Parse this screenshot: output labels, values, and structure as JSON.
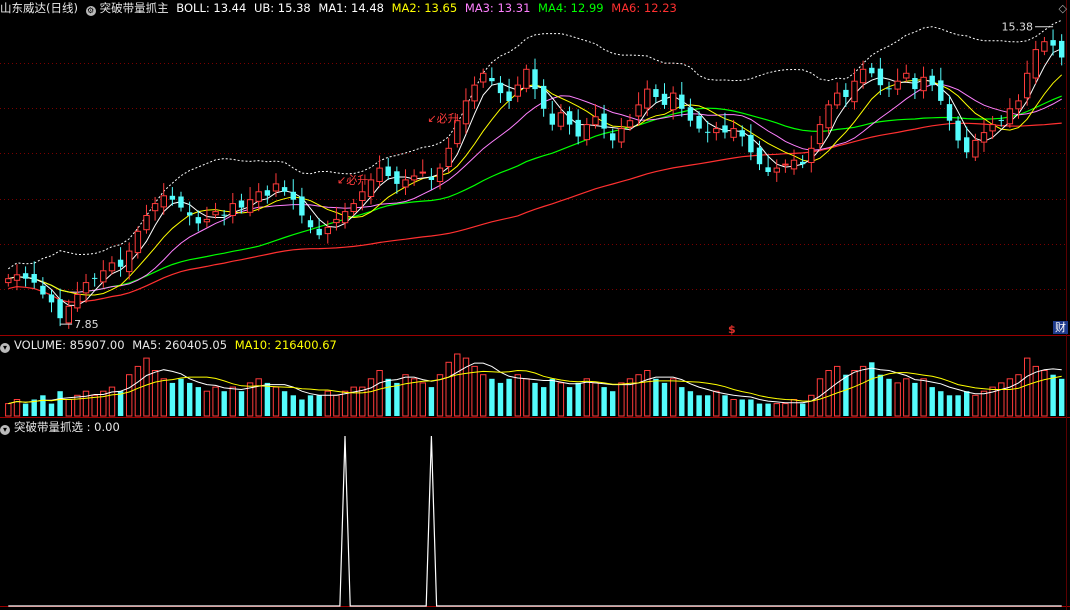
{
  "header_main": {
    "stock": "山东威达(日线)",
    "indicator": "突破带量抓主",
    "boll": "BOLL: 13.44",
    "ub": "UB: 15.38",
    "ma1": "MA1: 14.48",
    "ma2": "MA2: 13.65",
    "ma3": "MA3: 13.31",
    "ma4": "MA4: 12.99",
    "ma6": "MA6: 12.23"
  },
  "header_volume": {
    "volume": "VOLUME: 85907.00",
    "ma5": "MA5: 260405.05",
    "ma10": "MA10: 216400.67"
  },
  "header_signal": {
    "label": "突破带量抓选 : 0.00"
  },
  "annotations": {
    "high_label": "15.38",
    "low_label": "7.85",
    "bisheng_1": "↙必升",
    "bisheng_2": "↙必升",
    "dollar": "$",
    "cai": "财"
  },
  "colors": {
    "up": "#ff3b3b",
    "down": "#54fcfc",
    "ma1": "#ffffff",
    "ma2": "#ffff00",
    "ma3": "#ff80ff",
    "ma4": "#00ff00",
    "ma6": "#ff3030",
    "ub": "#ffffff",
    "boll_label": "#ffffff",
    "ub_label": "#ffffff",
    "ma1_label": "#ffffff",
    "ma2_label": "#ffff00",
    "ma3_label": "#ff80ff",
    "ma4_label": "#00ff00",
    "ma6_label": "#ff3030",
    "grid": "#7a0000"
  },
  "chart_data": [
    {
      "type": "candlestick",
      "y_range": [
        7.6,
        15.6
      ],
      "high": 15.38,
      "low": 7.85,
      "series": [
        {
          "name": "BOLL",
          "value": 13.44
        },
        {
          "name": "UB",
          "value": 15.38
        },
        {
          "name": "MA1",
          "value": 14.48
        },
        {
          "name": "MA2",
          "value": 13.65
        },
        {
          "name": "MA3",
          "value": 13.31
        },
        {
          "name": "MA4",
          "value": 12.99
        },
        {
          "name": "MA6",
          "value": 12.23
        }
      ],
      "closes": [
        9.0,
        9.1,
        9.0,
        8.9,
        8.6,
        8.4,
        8.0,
        8.3,
        8.6,
        8.9,
        9.0,
        9.2,
        9.4,
        9.3,
        9.7,
        10.2,
        10.6,
        10.9,
        11.1,
        11.0,
        10.8,
        10.6,
        10.4,
        10.5,
        10.7,
        10.6,
        10.9,
        10.8,
        11.0,
        11.2,
        11.1,
        11.4,
        11.2,
        11.0,
        10.6,
        10.3,
        10.1,
        10.3,
        10.5,
        10.7,
        10.9,
        11.2,
        11.5,
        11.8,
        11.6,
        11.4,
        11.5,
        11.6,
        11.7,
        11.5,
        11.8,
        12.3,
        13.0,
        13.5,
        13.9,
        14.2,
        14.0,
        13.7,
        13.5,
        13.9,
        14.3,
        13.8,
        13.3,
        12.9,
        13.2,
        12.9,
        12.6,
        12.9,
        13.1,
        12.8,
        12.5,
        12.8,
        13.0,
        13.4,
        13.8,
        13.6,
        13.4,
        13.7,
        13.3,
        13.0,
        12.8,
        12.7,
        12.8,
        12.7,
        12.8,
        12.6,
        12.2,
        11.9,
        11.7,
        11.8,
        11.9,
        12.0,
        11.9,
        12.3,
        12.9,
        13.4,
        13.7,
        13.6,
        14.0,
        14.3,
        14.2,
        13.9,
        13.8,
        14.0,
        14.2,
        13.8,
        14.1,
        13.9,
        13.5,
        13.0,
        12.5,
        12.2,
        12.5,
        12.7,
        12.9,
        13.0,
        13.3,
        13.5,
        14.2,
        14.8,
        15.0,
        14.9,
        14.6
      ]
    },
    {
      "type": "bar",
      "name": "VOLUME",
      "value": 85907.0,
      "series": [
        {
          "name": "MA5",
          "value": 260405.05
        },
        {
          "name": "MA10",
          "value": 216400.67
        }
      ],
      "values": [
        3,
        4,
        3,
        4,
        5,
        3,
        6,
        4,
        5,
        6,
        5,
        6,
        7,
        6,
        10,
        12,
        14,
        11,
        9,
        8,
        9,
        8,
        7,
        6,
        7,
        6,
        7,
        6,
        8,
        9,
        8,
        7,
        6,
        5,
        4,
        5,
        5,
        6,
        5,
        6,
        7,
        7,
        9,
        11,
        9,
        8,
        10,
        9,
        8,
        7,
        10,
        13,
        15,
        14,
        12,
        10,
        9,
        8,
        9,
        10,
        9,
        8,
        7,
        9,
        8,
        7,
        8,
        9,
        8,
        7,
        6,
        8,
        9,
        10,
        11,
        9,
        8,
        9,
        7,
        6,
        5,
        5,
        6,
        5,
        4,
        4,
        4,
        3,
        3,
        3,
        3,
        4,
        3,
        5,
        9,
        11,
        12,
        10,
        11,
        12,
        13,
        10,
        9,
        8,
        9,
        8,
        9,
        7,
        6,
        5,
        5,
        6,
        5,
        6,
        7,
        8,
        9,
        10,
        14,
        12,
        11,
        10,
        9
      ]
    },
    {
      "type": "line",
      "name": "突破带量抓选",
      "value": 0.0,
      "y_range": [
        0,
        1
      ],
      "spikes_at": [
        39,
        49
      ],
      "values": [
        0,
        0,
        0,
        0,
        0,
        0,
        0,
        0,
        0,
        0,
        0,
        0,
        0,
        0,
        0,
        0,
        0,
        0,
        0,
        0,
        0,
        0,
        0,
        0,
        0,
        0,
        0,
        0,
        0,
        0,
        0,
        0,
        0,
        0,
        0,
        0,
        0,
        0,
        0,
        1,
        0,
        0,
        0,
        0,
        0,
        0,
        0,
        0,
        0,
        1,
        0,
        0,
        0,
        0,
        0,
        0,
        0,
        0,
        0,
        0,
        0,
        0,
        0,
        0,
        0,
        0,
        0,
        0,
        0,
        0,
        0,
        0,
        0,
        0,
        0,
        0,
        0,
        0,
        0,
        0,
        0,
        0,
        0,
        0,
        0,
        0,
        0,
        0,
        0,
        0,
        0,
        0,
        0,
        0,
        0,
        0,
        0,
        0,
        0,
        0,
        0,
        0,
        0,
        0,
        0,
        0,
        0,
        0,
        0,
        0,
        0,
        0,
        0,
        0,
        0,
        0,
        0,
        0,
        0,
        0,
        0,
        0,
        0
      ]
    }
  ]
}
